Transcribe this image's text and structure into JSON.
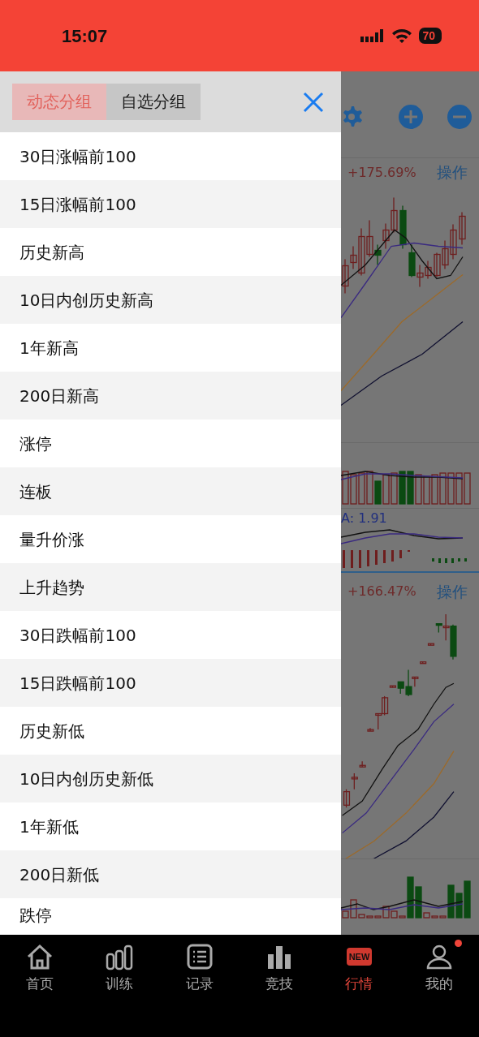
{
  "status_bar": {
    "time": "15:07",
    "battery": "70"
  },
  "drawer": {
    "tabs": [
      {
        "label": "动态分组",
        "selected": true
      },
      {
        "label": "自选分组",
        "selected": false
      }
    ],
    "items": [
      {
        "label": "30日涨幅前100"
      },
      {
        "label": "15日涨幅前100"
      },
      {
        "label": "历史新高"
      },
      {
        "label": "10日内创历史新高"
      },
      {
        "label": "1年新高"
      },
      {
        "label": "200日新高"
      },
      {
        "label": "涨停"
      },
      {
        "label": "连板"
      },
      {
        "label": "量升价涨"
      },
      {
        "label": "上升趋势"
      },
      {
        "label": "30日跌幅前100"
      },
      {
        "label": "15日跌幅前100"
      },
      {
        "label": "历史新低"
      },
      {
        "label": "10日内创历史新低"
      },
      {
        "label": "1年新低"
      },
      {
        "label": "200日新低"
      },
      {
        "label": "跌停"
      }
    ]
  },
  "background": {
    "panels": [
      {
        "change": "+175.69%",
        "action": "操作",
        "indicator": "A: 1.91"
      },
      {
        "change": "+166.47%",
        "action": "操作"
      }
    ]
  },
  "tab_bar": [
    {
      "label": "首页",
      "selected": false
    },
    {
      "label": "训练",
      "selected": false
    },
    {
      "label": "记录",
      "selected": false
    },
    {
      "label": "竞技",
      "selected": false
    },
    {
      "label": "行情",
      "selected": true,
      "icon_text": "NEW"
    },
    {
      "label": "我的",
      "selected": false,
      "dot": true
    }
  ]
}
